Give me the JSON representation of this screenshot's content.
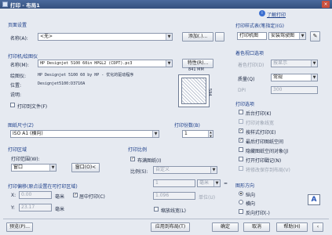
{
  "window": {
    "title": "打印 - 布局1",
    "close_glyph": "×"
  },
  "help_link": "了解打印",
  "page_setup": {
    "group": "页面设置",
    "name_label": "名称(A):",
    "name_value": "<无>",
    "add_button": "添加(.)..."
  },
  "printer": {
    "group": "打印机/绘图仪",
    "name_label": "名称(M):",
    "name_value": "HP Designjet 5100 60in HPGL2 (CDPT).pc3",
    "properties_button": "特性(R)...",
    "plotter_label": "绘图仪:",
    "plotter_value": "HP Designjet 5100 60 by HP - 优化的驱动程序",
    "location_label": "位置:",
    "location_value": "Designjet5100:D3710A",
    "description_label": "说明:",
    "print_to_file_label": "打印到文件(F)",
    "preview_width": "841 MM",
    "preview_height": "594"
  },
  "paper_size": {
    "group": "图纸尺寸(Z)",
    "value": "ISO A1 (横向)"
  },
  "copies": {
    "label": "打印份数(B)",
    "value": "1"
  },
  "plot_area": {
    "group": "打印区域",
    "what_label": "打印范围(W):",
    "what_value": "窗口",
    "window_button": "窗口(O)<"
  },
  "plot_offset": {
    "group": "打印偏移(原点设置在可打印区域)",
    "x_label": "X:",
    "x_value": "0.00",
    "y_label": "Y:",
    "y_value": "23.17",
    "unit": "毫米",
    "center_label": "居中打印(C)"
  },
  "plot_scale": {
    "group": "打印比例",
    "fit_label": "布满图纸(I)",
    "scale_label": "比例(S):",
    "scale_value": "自定义",
    "val1": "1",
    "unit_label": "毫米",
    "val2": "1.096",
    "unit2": "单位(U)",
    "lineweights_label": "缩放线宽(L)"
  },
  "plot_style": {
    "group": "打印样式表(笔指定)(G)",
    "value": "打印机图",
    "value2": "安装驾驶图"
  },
  "shaded": {
    "group": "着色视口选项",
    "shade_label": "着色打印(D)",
    "shade_value": "按显示",
    "quality_label": "质量(Q)",
    "quality_value": "常规",
    "dpi_label": "DPI",
    "dpi_value": "300"
  },
  "options": {
    "group": "打印选项",
    "items": [
      {
        "label": "后台打印(K)",
        "checked": false,
        "disabled": false
      },
      {
        "label": "打印对象线宽",
        "checked": false,
        "disabled": true
      },
      {
        "label": "按样式打印(E)",
        "checked": true,
        "disabled": false
      },
      {
        "label": "最后打印图纸空间",
        "checked": true,
        "disabled": false
      },
      {
        "label": "隐藏图纸空间对象(J)",
        "checked": false,
        "disabled": false
      },
      {
        "label": "打开打印戳记(N)",
        "checked": false,
        "disabled": false
      },
      {
        "label": "将修改保存到布局(V)",
        "checked": false,
        "disabled": true
      }
    ]
  },
  "orientation": {
    "group": "图形方向",
    "portrait": "纵向",
    "landscape": "横向",
    "upside": "反向打印(-)"
  },
  "footer": {
    "preview": "预览(P)...",
    "apply": "应用到布局(T)",
    "ok": "确定",
    "cancel": "取消",
    "help": "帮助(H)"
  }
}
